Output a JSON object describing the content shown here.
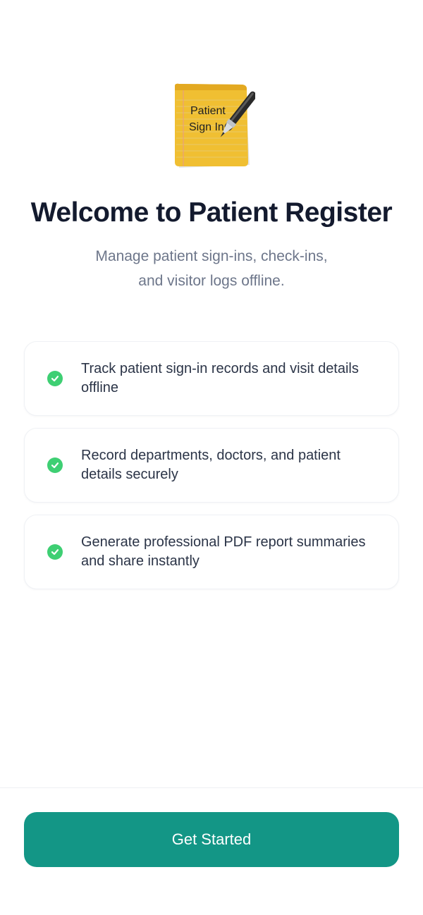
{
  "app_icon": {
    "name": "patient-sign-in-notepad-icon",
    "line1": "Patient",
    "line2": "Sign In"
  },
  "welcome": {
    "title": "Welcome to Patient Register",
    "subtitle_line1": "Manage patient sign-ins, check-ins,",
    "subtitle_line2": "and visitor logs offline."
  },
  "features": [
    {
      "icon": "check-circle-icon",
      "text": "Track patient sign-in records and visit details offline"
    },
    {
      "icon": "check-circle-icon",
      "text": "Record departments, doctors, and patient details securely"
    },
    {
      "icon": "check-circle-icon",
      "text": "Generate professional PDF report summaries and share instantly"
    }
  ],
  "cta": {
    "label": "Get Started"
  },
  "colors": {
    "accent": "#139686",
    "check": "#3ecf73",
    "title": "#131a2e",
    "subtitle": "#6d768a",
    "notepad": "#f0bf32"
  }
}
